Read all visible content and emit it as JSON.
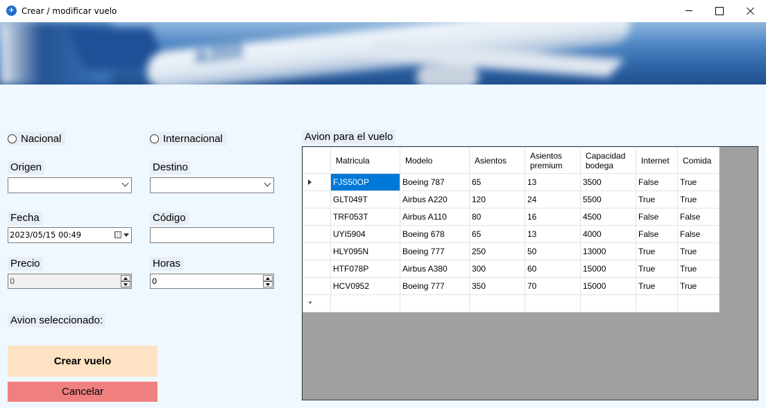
{
  "window": {
    "title": "Crear / modificar vuelo"
  },
  "banner": {
    "model_text": "A350"
  },
  "form": {
    "nacional_label": "Nacional",
    "internacional_label": "Internacional",
    "origen_label": "Origen",
    "origen_value": "",
    "destino_label": "Destino",
    "destino_value": "",
    "fecha_label": "Fecha",
    "fecha_value": "2023/05/15 00:49",
    "codigo_label": "Código",
    "codigo_value": "",
    "precio_label": "Precio",
    "precio_value": "0",
    "horas_label": "Horas",
    "horas_value": "0",
    "avion_seleccionado_label": "Avion seleccionado:",
    "avion_seleccionado_value": ""
  },
  "buttons": {
    "crear": "Crear vuelo",
    "cancelar": "Cancelar"
  },
  "grid": {
    "title": "Avion para el vuelo",
    "columns": [
      "Matricula",
      "Modelo",
      "Asientos",
      "Asientos premium",
      "Capacidad bodega",
      "Internet",
      "Comida"
    ],
    "rows": [
      [
        "FJS50OP",
        "Boeing 787",
        "65",
        "13",
        "3500",
        "False",
        "True"
      ],
      [
        "GLT049T",
        "Airbus A220",
        "120",
        "24",
        "5500",
        "True",
        "True"
      ],
      [
        "TRF053T",
        "Airbus A110",
        "80",
        "16",
        "4500",
        "False",
        "False"
      ],
      [
        "UYI5904",
        "Boeing 678",
        "65",
        "13",
        "4000",
        "False",
        "False"
      ],
      [
        "HLY095N",
        "Boeing 777",
        "250",
        "50",
        "13000",
        "True",
        "True"
      ],
      [
        "HTF078P",
        "Airbus A380",
        "300",
        "60",
        "15000",
        "True",
        "True"
      ],
      [
        "HCV0952",
        "Boeing 777",
        "350",
        "70",
        "15000",
        "True",
        "True"
      ]
    ],
    "selected_row": 0,
    "new_row_marker": "*"
  },
  "colors": {
    "background": "#f0f8ff",
    "crear_button": "#fde3c3",
    "cancelar_button": "#f08080",
    "selection": "#0078d7"
  }
}
